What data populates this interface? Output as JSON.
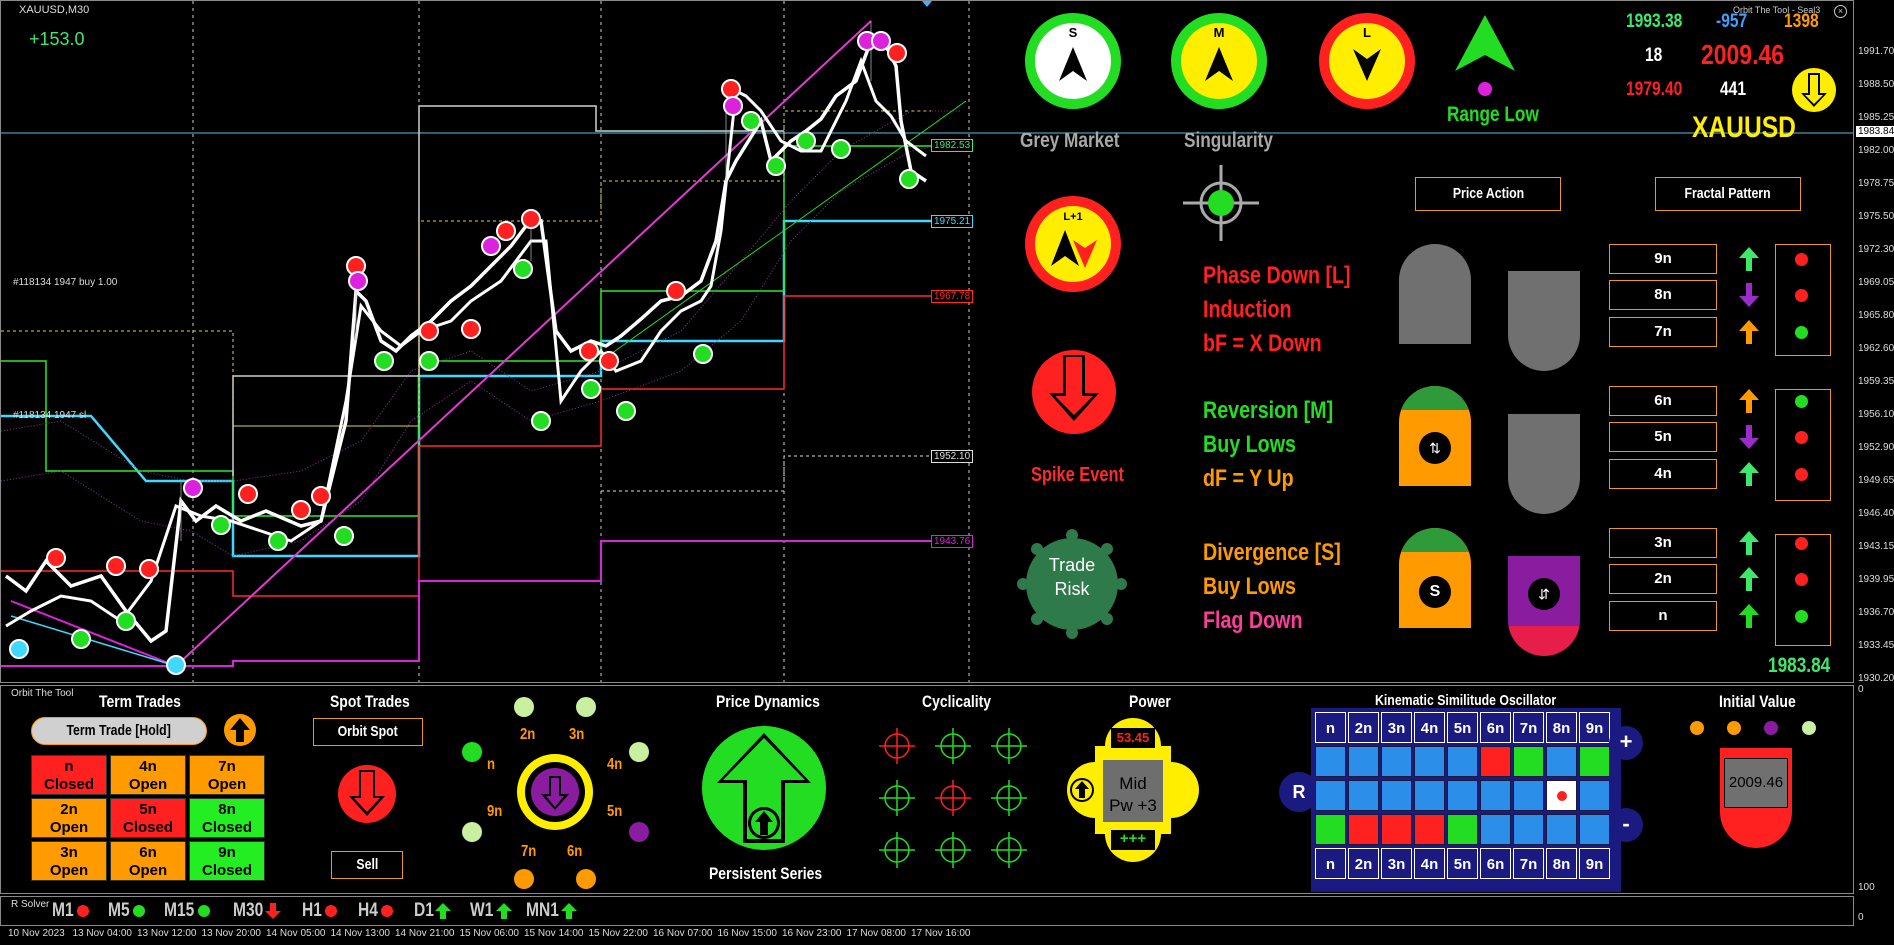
{
  "symbol": "XAUUSD,M30",
  "pnl": "+153.0",
  "orders": {
    "buy": "#118134 1947 buy 1.00",
    "sl": "#118134 1947 sl"
  },
  "price_tags": [
    "1983.84",
    "1982.53",
    "1975.21",
    "1967.78",
    "1952.10",
    "1943.76"
  ],
  "yaxis": [
    "1991.70",
    "1988.50",
    "1985.25",
    "1983.84",
    "1982.00",
    "1978.75",
    "1975.50",
    "1972.30",
    "1969.05",
    "1965.80",
    "1962.60",
    "1959.35",
    "1956.10",
    "1952.90",
    "1949.65",
    "1946.40",
    "1943.15",
    "1939.95",
    "1936.70",
    "1933.45",
    "1930.20",
    "0",
    "100",
    "0"
  ],
  "xaxis": [
    "10 Nov 2023",
    "13 Nov 04:00",
    "13 Nov 12:00",
    "13 Nov 20:00",
    "14 Nov 05:00",
    "14 Nov 13:00",
    "14 Nov 21:00",
    "15 Nov 06:00",
    "15 Nov 14:00",
    "15 Nov 22:00",
    "16 Nov 07:00",
    "16 Nov 15:00",
    "16 Nov 23:00",
    "17 Nov 08:00",
    "17 Nov 16:00"
  ],
  "panel": {
    "compass": [
      "S",
      "M",
      "L"
    ],
    "range_label": "Range Low",
    "grey_market": "Grey Market",
    "singularity": "Singularity",
    "l_plus": "L+1",
    "spike": "Spike Event",
    "trade_risk": [
      "Trade",
      "Risk"
    ],
    "title_top": "Orbit The Tool - Seal3",
    "stats": {
      "a": "1993.38",
      "b": "-957",
      "c": "1398",
      "d": "18",
      "e": "2009.46",
      "f": "1979.40",
      "g": "441"
    },
    "symbol_big": "XAUUSD",
    "current_price": "1983.84",
    "price_action": "Price Action",
    "fractal_pattern": "Fractal Pattern",
    "phase": [
      {
        "lines": [
          "Phase Down [L]",
          "Induction",
          "bF = X Down"
        ],
        "colors": [
          "#ff2020",
          "#ff2020",
          "#ff2020"
        ]
      },
      {
        "lines": [
          "Reversion [M]",
          "Buy Lows",
          "dF = Y Up"
        ],
        "colors": [
          "#22dd22",
          "#22dd22",
          "#ff9a00"
        ]
      },
      {
        "lines": [
          "Divergence [S]",
          "Buy Lows",
          "Flag Down"
        ],
        "colors": [
          "#ff9a00",
          "#ff9a00",
          "#ff3c9a"
        ]
      }
    ],
    "levels": [
      "9n",
      "8n",
      "7n",
      "6n",
      "5n",
      "4n",
      "3n",
      "2n",
      "n"
    ],
    "level_arrows": [
      {
        "dir": "up",
        "color": "#3ee86a"
      },
      {
        "dir": "down",
        "color": "#9a2ccc"
      },
      {
        "dir": "up",
        "color": "#ff9a00"
      },
      {
        "dir": "up",
        "color": "#ff9a00"
      },
      {
        "dir": "down",
        "color": "#9a2ccc"
      },
      {
        "dir": "up",
        "color": "#3ee86a"
      },
      {
        "dir": "up",
        "color": "#3ee86a"
      },
      {
        "dir": "up",
        "color": "#3ee86a"
      },
      {
        "dir": "up",
        "color": "#22dd22"
      }
    ],
    "level_dots": [
      "#ff2020",
      "#ff2020",
      "#22dd22",
      "#22dd22",
      "#ff2020",
      "#ff2020",
      "#ff2020",
      "#ff2020",
      "#22dd22"
    ]
  },
  "sub": {
    "orbit": "Orbit The Tool",
    "term_trades": "Term Trades",
    "term_trade_hold": "Term Trade [Hold]",
    "trades": [
      {
        "l1": "n",
        "l2": "Closed",
        "bg": "#ff2020"
      },
      {
        "l1": "4n",
        "l2": "Open",
        "bg": "#ff9a00"
      },
      {
        "l1": "7n",
        "l2": "Open",
        "bg": "#ff9a00"
      },
      {
        "l1": "2n",
        "l2": "Open",
        "bg": "#ff9a00"
      },
      {
        "l1": "5n",
        "l2": "Closed",
        "bg": "#ff2020"
      },
      {
        "l1": "8n",
        "l2": "Closed",
        "bg": "#22ee22"
      },
      {
        "l1": "3n",
        "l2": "Open",
        "bg": "#ff9a00"
      },
      {
        "l1": "6n",
        "l2": "Open",
        "bg": "#ff9a00"
      },
      {
        "l1": "9n",
        "l2": "Closed",
        "bg": "#22ee22"
      }
    ],
    "spot_trades": "Spot Trades",
    "orbit_spot": "Orbit Spot",
    "sell": "Sell",
    "orbit_labels": [
      "2n",
      "3n",
      "4n",
      "5n",
      "6n",
      "7n",
      "9n",
      "n"
    ],
    "price_dynamics": "Price Dynamics",
    "persistent": "Persistent Series",
    "cyclicality": "Cyclicality",
    "power": "Power",
    "power_value": "53.45",
    "power_mid": "Mid",
    "power_pw": "Pw +3",
    "power_plus": "+++",
    "kso": "Kinematic Similitude Oscillator",
    "kso_headers": [
      "n",
      "2n",
      "3n",
      "4n",
      "5n",
      "6n",
      "7n",
      "8n",
      "9n"
    ],
    "kso_rows": [
      [
        "#2b8ee8",
        "#2b8ee8",
        "#2b8ee8",
        "#2b8ee8",
        "#2b8ee8",
        "#ff2020",
        "#22dd22",
        "#2b8ee8",
        "#22dd22"
      ],
      [
        "#2b8ee8",
        "#2b8ee8",
        "#2b8ee8",
        "#2b8ee8",
        "#2b8ee8",
        "#2b8ee8",
        "#2b8ee8",
        "#ffffff",
        "#2b8ee8"
      ],
      [
        "#22dd22",
        "#ff2020",
        "#ff2020",
        "#ff2020",
        "#22dd22",
        "#2b8ee8",
        "#2b8ee8",
        "#2b8ee8",
        "#2b8ee8"
      ]
    ],
    "kso_r": "R",
    "kso_plus": "+",
    "kso_minus": "-",
    "initial_value": "Initial Value",
    "initial_price": "2009.46"
  },
  "ind": {
    "label": "R Solver",
    "tfs": [
      {
        "name": "M1",
        "mark": "dot",
        "color": "#ff2020"
      },
      {
        "name": "M5",
        "mark": "dot",
        "color": "#22dd22"
      },
      {
        "name": "M15",
        "mark": "dot",
        "color": "#22dd22"
      },
      {
        "name": "M30",
        "mark": "down",
        "color": "#ff2020"
      },
      {
        "name": "H1",
        "mark": "dot",
        "color": "#ff2020"
      },
      {
        "name": "H4",
        "mark": "dot",
        "color": "#ff2020"
      },
      {
        "name": "D1",
        "mark": "up",
        "color": "#22dd22"
      },
      {
        "name": "W1",
        "mark": "up",
        "color": "#22dd22"
      },
      {
        "name": "MN1",
        "mark": "up",
        "color": "#22dd22"
      }
    ]
  }
}
